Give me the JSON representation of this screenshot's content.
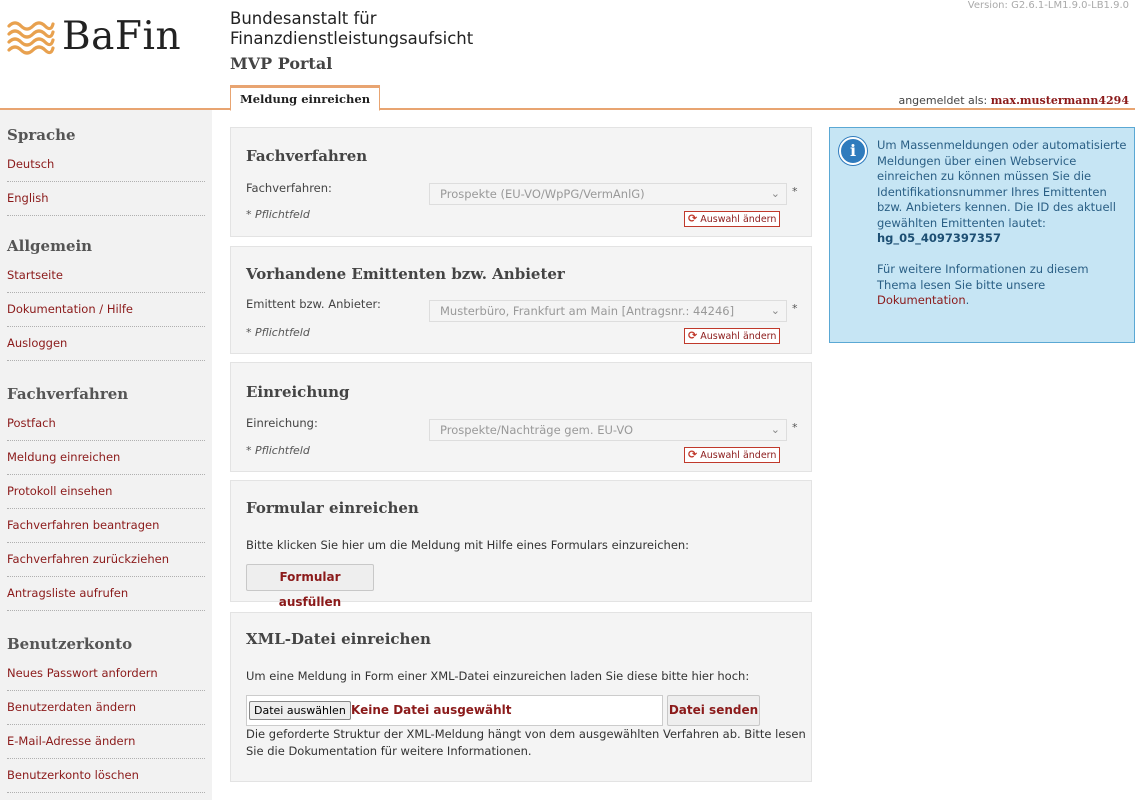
{
  "header": {
    "logo_text": "BaFin",
    "org_line1": "Bundesanstalt für",
    "org_line2": "Finanzdienstleistungsaufsicht",
    "portal": "MVP Portal",
    "version": "Version: G2.6.1-LM1.9.0-LB1.9.0",
    "tab": "Meldung einreichen",
    "logged_in_label": "angemeldet als:",
    "username": "max.mustermann4294"
  },
  "sidebar": {
    "sections": [
      {
        "title": "Sprache",
        "items": [
          "Deutsch",
          "English"
        ]
      },
      {
        "title": "Allgemein",
        "items": [
          "Startseite",
          "Dokumentation / Hilfe",
          "Ausloggen"
        ]
      },
      {
        "title": "Fachverfahren",
        "items": [
          "Postfach",
          "Meldung einreichen",
          "Protokoll einsehen",
          "Fachverfahren beantragen",
          "Fachverfahren zurückziehen",
          "Antragsliste aufrufen"
        ]
      },
      {
        "title": "Benutzerkonto",
        "items": [
          "Neues Passwort anfordern",
          "Benutzerdaten ändern",
          "E-Mail-Adresse ändern",
          "Benutzerkonto löschen"
        ]
      }
    ]
  },
  "panels": {
    "fachverfahren": {
      "title": "Fachverfahren",
      "label": "Fachverfahren:",
      "value": "Prospekte (EU-VO/WpPG/VermAnlG)",
      "required": "*",
      "note": "* Pflichtfeld",
      "change": "Auswahl ändern"
    },
    "emittent": {
      "title": "Vorhandene Emittenten bzw. Anbieter",
      "label": "Emittent bzw. Anbieter:",
      "value": "Musterbüro, Frankfurt am Main [Antragsnr.: 44246]",
      "required": "*",
      "note": "* Pflichtfeld",
      "change": "Auswahl ändern"
    },
    "einreichung": {
      "title": "Einreichung",
      "label": "Einreichung:",
      "value": "Prospekte/Nachträge gem. EU-VO",
      "required": "*",
      "note": "* Pflichtfeld",
      "change": "Auswahl ändern"
    },
    "formular": {
      "title": "Formular einreichen",
      "text": "Bitte klicken Sie hier um die Meldung mit Hilfe eines Formulars einzureichen:",
      "button": "Formular ausfüllen"
    },
    "xml": {
      "title": "XML-Datei einreichen",
      "text": "Um eine Meldung in Form einer XML-Datei einzureichen laden Sie diese bitte hier hoch:",
      "choose_button": "Datei auswählen",
      "no_file": "Keine Datei ausgewählt",
      "send_button": "Datei senden",
      "hint_line1": "Die geforderte Struktur der XML-Meldung hängt von dem ausgewählten Verfahren ab. Bitte lesen",
      "hint_line2": "Sie die Dokumentation für weitere Informationen."
    }
  },
  "info": {
    "line1": "Um Massenmeldungen oder automatisierte",
    "line2": "Meldungen über einen Webservice",
    "line3": "einreichen zu können müssen Sie die",
    "line4": "Identifikationsnummer Ihres Emittenten",
    "line5": "bzw. Anbieters kennen. Die ID des aktuell",
    "line6": "gewählten Emittenten lautet:",
    "id": "hg_05_4097397357",
    "more1": "Für weitere Informationen zu diesem",
    "more2": "Thema lesen Sie bitte unsere",
    "link": "Dokumentation",
    "period": "."
  },
  "colors": {
    "accent": "#e8a471",
    "link": "#8b1a1a",
    "info_bg": "#c6e5f4",
    "info_border": "#5aa8d4"
  }
}
